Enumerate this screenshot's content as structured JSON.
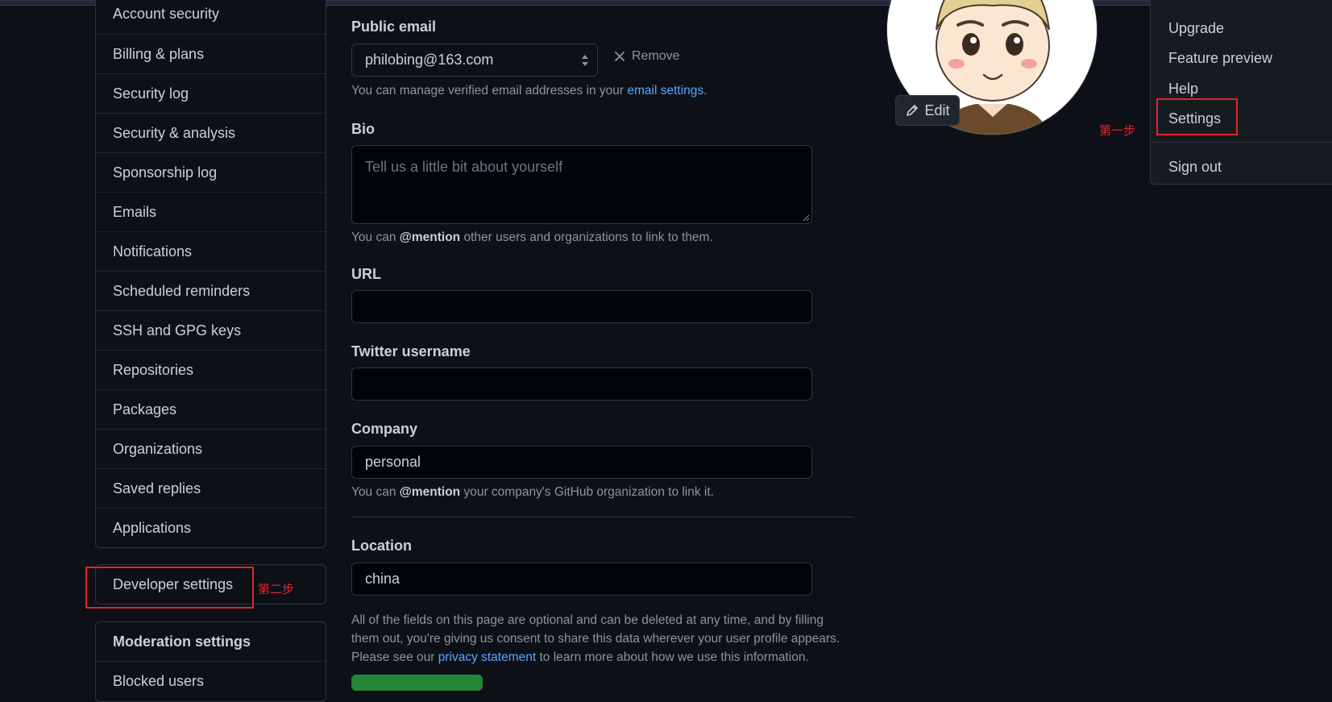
{
  "sidebar": {
    "items": [
      {
        "label": "Account security"
      },
      {
        "label": "Billing & plans"
      },
      {
        "label": "Security log"
      },
      {
        "label": "Security & analysis"
      },
      {
        "label": "Sponsorship log"
      },
      {
        "label": "Emails"
      },
      {
        "label": "Notifications"
      },
      {
        "label": "Scheduled reminders"
      },
      {
        "label": "SSH and GPG keys"
      },
      {
        "label": "Repositories"
      },
      {
        "label": "Packages"
      },
      {
        "label": "Organizations"
      },
      {
        "label": "Saved replies"
      },
      {
        "label": "Applications"
      }
    ],
    "developer_settings": "Developer settings",
    "moderation": {
      "heading": "Moderation settings",
      "items": [
        {
          "label": "Blocked users"
        }
      ]
    }
  },
  "annotations": {
    "step1": "第一步",
    "step2": "第二步"
  },
  "form": {
    "public_email": {
      "label": "Public email",
      "value": "philobing@163.com",
      "remove_label": "Remove",
      "note_before": "You can manage verified email addresses in your ",
      "note_link": "email settings",
      "note_after": "."
    },
    "bio": {
      "label": "Bio",
      "placeholder": "Tell us a little bit about yourself",
      "note_before": "You can ",
      "note_mention": "@mention",
      "note_after": " other users and organizations to link to them."
    },
    "url": {
      "label": "URL",
      "value": ""
    },
    "twitter": {
      "label": "Twitter username",
      "value": ""
    },
    "company": {
      "label": "Company",
      "value": "personal",
      "note_before": "You can ",
      "note_mention": "@mention",
      "note_after": " your company's GitHub organization to link it."
    },
    "location": {
      "label": "Location",
      "value": "china"
    },
    "footer": {
      "line1": "All of the fields on this page are optional and can be deleted at any time, and by filling",
      "line2": "them out, you're giving us consent to share this data wherever your user profile appears.",
      "line3_before": "Please see our ",
      "line3_link": "privacy statement",
      "line3_after": " to learn more about how we use this information."
    }
  },
  "avatar": {
    "edit_label": "Edit"
  },
  "menu": {
    "items": [
      {
        "label": "Upgrade"
      },
      {
        "label": "Feature preview"
      },
      {
        "label": "Help"
      },
      {
        "label": "Settings"
      }
    ],
    "sign_out": "Sign out"
  },
  "colors": {
    "background": "#0d1117",
    "border": "#30363d",
    "link": "#58a6ff",
    "annotation_red": "#e5222a",
    "primary_button": "#238636"
  }
}
